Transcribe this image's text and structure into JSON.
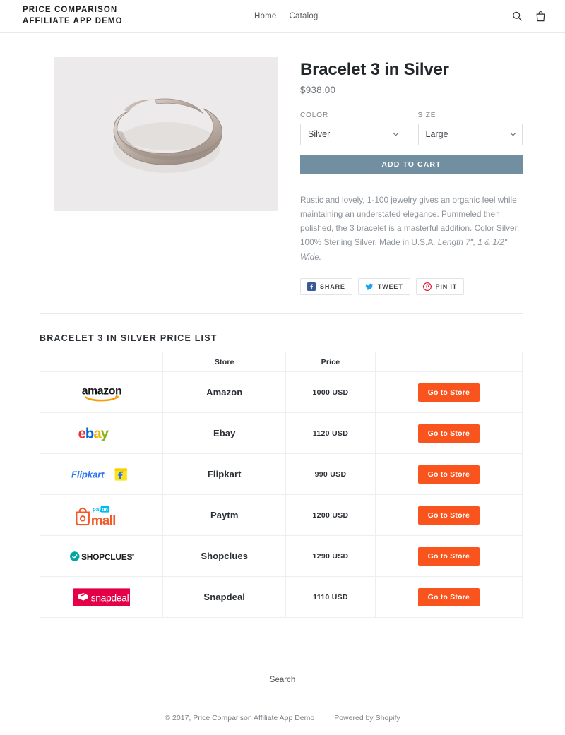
{
  "header": {
    "brand_line1": "PRICE COMPARISON",
    "brand_line2": "AFFILIATE APP DEMO",
    "nav": [
      {
        "label": "Home"
      },
      {
        "label": "Catalog"
      }
    ],
    "search_icon": "search-icon",
    "cart_icon": "shopping-bag-icon"
  },
  "product": {
    "title": "Bracelet 3 in Silver",
    "price": "$938.00",
    "image_alt": "Silver cuff bracelet on light gray background",
    "color_label": "COLOR",
    "color_value": "Silver",
    "color_options": [
      "Silver"
    ],
    "size_label": "SIZE",
    "size_value": "Large",
    "size_options": [
      "Large"
    ],
    "add_to_cart_label": "ADD TO CART",
    "description_main": "Rustic and lovely, 1-100 jewelry gives an organic feel while maintaining an understated elegance. Pummeled then polished, the 3 bracelet is a masterful addition. Color Silver. 100% Sterling Silver. Made in U.S.A. ",
    "description_em": "Length 7\", 1 & 1/2\" Wide.",
    "share": [
      {
        "label": "SHARE",
        "icon": "facebook-icon",
        "color": "#3b5998"
      },
      {
        "label": "TWEET",
        "icon": "twitter-icon",
        "color": "#1da1f2"
      },
      {
        "label": "PIN IT",
        "icon": "pinterest-icon",
        "color": "#e60023"
      }
    ]
  },
  "pricelist": {
    "title": "BRACELET 3 IN SILVER PRICE LIST",
    "columns": [
      "Store",
      "Price",
      ""
    ],
    "rows": [
      {
        "logo": "amazon-logo",
        "store": "Amazon",
        "price": "1000 USD",
        "action": "Go to Store"
      },
      {
        "logo": "ebay-logo",
        "store": "Ebay",
        "price": "1120 USD",
        "action": "Go to Store"
      },
      {
        "logo": "flipkart-logo",
        "store": "Flipkart",
        "price": "990 USD",
        "action": "Go to Store"
      },
      {
        "logo": "paytm-mall-logo",
        "store": "Paytm",
        "price": "1200 USD",
        "action": "Go to Store"
      },
      {
        "logo": "shopclues-logo",
        "store": "Shopclues",
        "price": "1290 USD",
        "action": "Go to Store"
      },
      {
        "logo": "snapdeal-logo",
        "store": "Snapdeal",
        "price": "1110 USD",
        "action": "Go to Store"
      }
    ]
  },
  "footer": {
    "search_label": "Search",
    "copyright": "© 2017, Price Comparison Affiliate App Demo",
    "powered_by": "Powered by Shopify"
  },
  "colors": {
    "add_to_cart": "#718fa1",
    "go_to_store": "#f9541e",
    "text_dark": "#2b3036",
    "text_muted": "#8d9399",
    "border": "#edeef0"
  }
}
